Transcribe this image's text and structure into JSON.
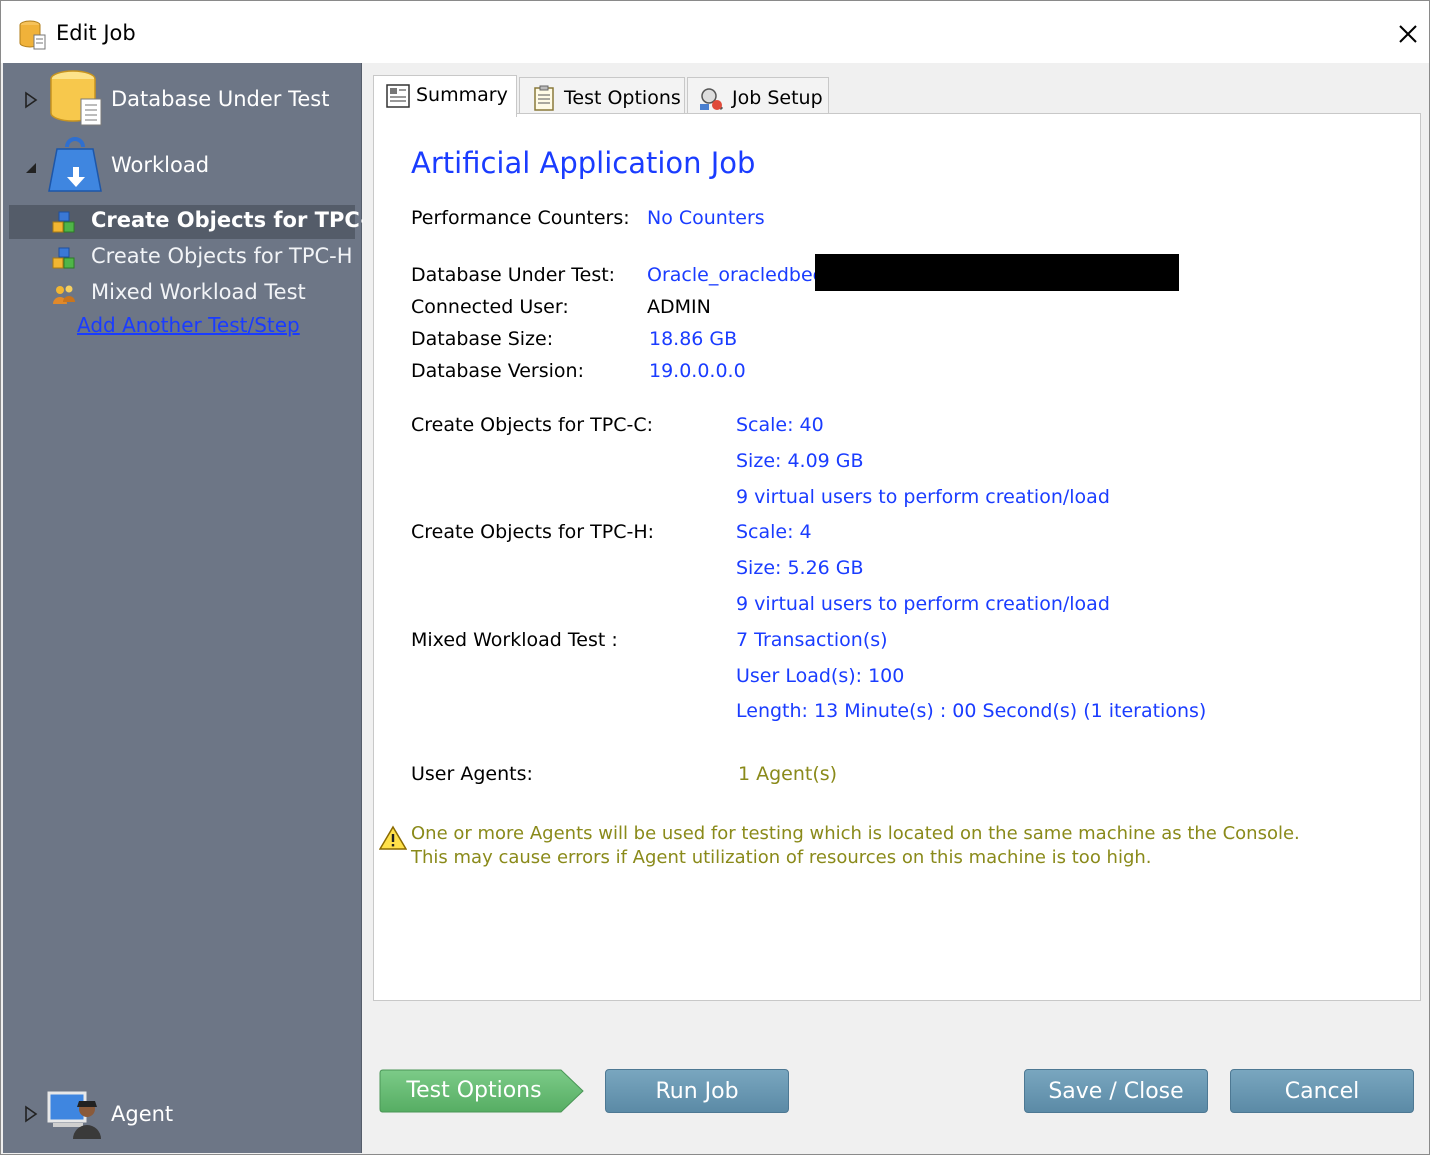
{
  "window": {
    "title": "Edit Job"
  },
  "sidebar": {
    "database_under_test": "Database Under Test",
    "workload": "Workload",
    "steps": [
      "Create Objects for TPC-C",
      "Create Objects for TPC-H",
      "Mixed Workload Test"
    ],
    "add_link": "Add Another Test/Step",
    "agent": "Agent"
  },
  "tabs": [
    "Summary",
    "Test Options",
    "Job Setup"
  ],
  "summary": {
    "heading": "Artificial Application Job",
    "performance_counters_label": "Performance Counters:",
    "performance_counters_value": "No Counters",
    "database_under_test_label": "Database Under Test:",
    "database_under_test_value": "Oracle_oracledbee.",
    "connected_user_label": "Connected User:",
    "connected_user_value": "ADMIN",
    "database_size_label": "Database Size:",
    "database_size_value": "18.86 GB",
    "database_version_label": "Database Version:",
    "database_version_value": "19.0.0.0.0",
    "tpcc_label": "Create Objects for TPC-C:",
    "tpcc_scale": "Scale: 40",
    "tpcc_size": "Size: 4.09 GB",
    "tpcc_users": "9 virtual users to perform creation/load",
    "tpch_label": "Create Objects for TPC-H:",
    "tpch_scale": "Scale: 4",
    "tpch_size": "Size: 5.26 GB",
    "tpch_users": "9 virtual users to perform creation/load",
    "mixed_label": "Mixed Workload Test :",
    "mixed_transactions": "7 Transaction(s)",
    "mixed_user_load": "User Load(s): 100",
    "mixed_length": "Length: 13 Minute(s) : 00 Second(s) (1 iterations)",
    "user_agents_label": "User Agents:",
    "user_agents_value": "1 Agent(s)",
    "warning_line1": "One or more Agents will be used for testing which is located on the same machine as the Console.",
    "warning_line2": "This may cause errors if Agent utilization of resources on this machine is too high."
  },
  "buttons": {
    "test_options": "Test Options",
    "run_job": "Run Job",
    "save_close": "Save / Close",
    "cancel": "Cancel"
  },
  "colors": {
    "sidebar_bg": "#6d7686",
    "link_blue": "#1a3cff",
    "warning_olive": "#8a8a1a",
    "button_blue": "#5b8aa6",
    "button_green": "#5fb86e"
  }
}
